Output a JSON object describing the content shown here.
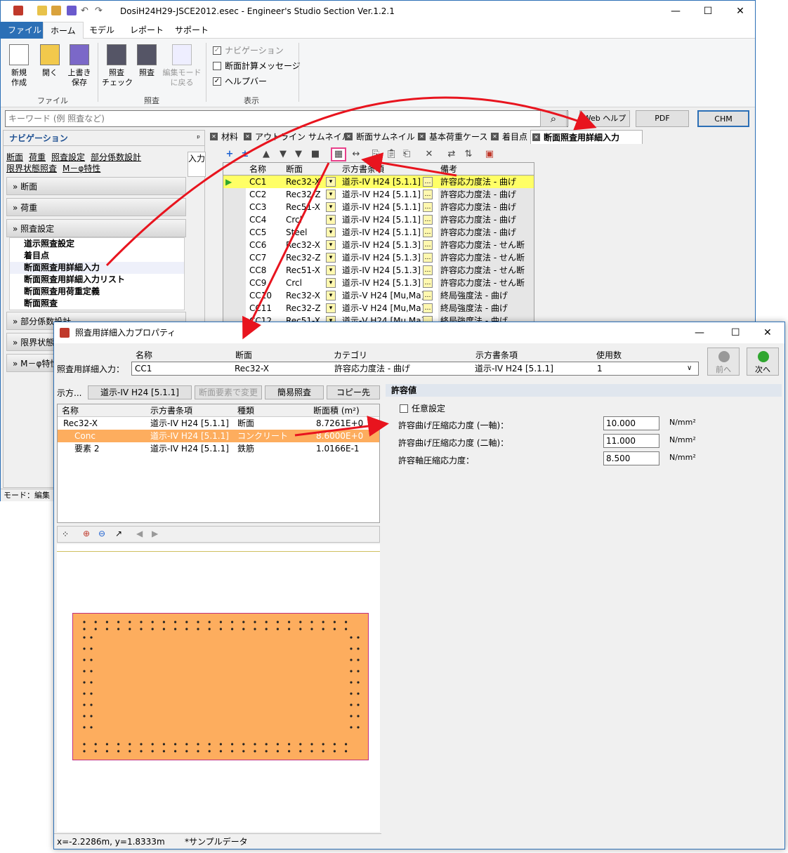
{
  "window": {
    "title": "DosiH24H29-JSCE2012.esec - Engineer's Studio Section Ver.1.2.1",
    "menus": [
      "ファイル",
      "ホーム",
      "モデル",
      "レポート",
      "サポート"
    ],
    "ribbon": {
      "file_group": "ファイル",
      "check_group": "照査",
      "view_group": "表示",
      "buttons": {
        "new": "新規\n作成",
        "open": "開く",
        "save": "上書き\n保存",
        "check_check": "照査\nチェック",
        "check": "照査",
        "back": "編集モード\nに戻る"
      },
      "checks": {
        "navigation": "ナビゲーション",
        "message": "断面計算メッセージ",
        "helpbar": "ヘルプバー"
      }
    },
    "search": {
      "placeholder": "キーワード (例 照査など)",
      "web_help": "Web ヘルプ",
      "pdf": "PDF",
      "chm": "CHM"
    },
    "nav": {
      "title": "ナビゲーション",
      "pin": "ᵖ",
      "links": [
        "断面",
        "荷重",
        "照査設定",
        "部分係数設計",
        "限界状態照査",
        "M－φ特性"
      ],
      "side_tab": "入力",
      "sections": [
        "断面",
        "荷重",
        "照査設定",
        "部分係数設計",
        "限界状態照",
        "M－φ特性"
      ],
      "sub_items": [
        "道示照査設定",
        "着目点",
        "断面照査用詳細入力",
        "断面照査用詳細入力リスト",
        "断面照査用荷重定義",
        "断面照査"
      ]
    },
    "status": "モード：編集",
    "tabs": [
      "材料",
      "アウトライン サムネイル",
      "断面サムネイル",
      "基本荷重ケース",
      "着目点",
      "断面照査用詳細入力"
    ],
    "grid": {
      "headers": [
        "名称",
        "断面",
        "示方書条項",
        "備考"
      ],
      "rows": [
        [
          "CC1",
          "Rec32-X",
          "道示-IV H24 [5.1.1]",
          "許容応力度法 - 曲げ"
        ],
        [
          "CC2",
          "Rec32-Z",
          "道示-IV H24 [5.1.1]",
          "許容応力度法 - 曲げ"
        ],
        [
          "CC3",
          "Rec51-X",
          "道示-IV H24 [5.1.1]",
          "許容応力度法 - 曲げ"
        ],
        [
          "CC4",
          "Crcl",
          "道示-IV H24 [5.1.1]",
          "許容応力度法 - 曲げ"
        ],
        [
          "CC5",
          "Steel",
          "道示-IV H24 [5.1.1]",
          "許容応力度法 - 曲げ"
        ],
        [
          "CC6",
          "Rec32-X",
          "道示-IV H24 [5.1.3]",
          "許容応力度法 - せん断"
        ],
        [
          "CC7",
          "Rec32-Z",
          "道示-IV H24 [5.1.3]",
          "許容応力度法 - せん断"
        ],
        [
          "CC8",
          "Rec51-X",
          "道示-IV H24 [5.1.3]",
          "許容応力度法 - せん断"
        ],
        [
          "CC9",
          "Crcl",
          "道示-IV H24 [5.1.3]",
          "許容応力度法 - せん断"
        ],
        [
          "CC10",
          "Rec32-X",
          "道示-V H24 [Mu,Ma]",
          "終局強度法 - 曲げ"
        ],
        [
          "CC11",
          "Rec32-Z",
          "道示-V H24 [Mu,Ma]",
          "終局強度法 - 曲げ"
        ],
        [
          "CC12",
          "Rec51-X",
          "道示-V H24 [Mu,Ma]",
          "終局強度法 - 曲げ"
        ]
      ]
    }
  },
  "dialog": {
    "title": "照査用詳細入力プロパティ",
    "select_label": "照査用詳細入力：",
    "select_headers": [
      "名称",
      "断面",
      "カテゴリ",
      "示方書条項",
      "使用数"
    ],
    "select_values": [
      "CC1",
      "Rec32-X",
      "許容応力度法 - 曲げ",
      "道示-IV H24 [5.1.1]",
      "1"
    ],
    "prev": "前へ",
    "next": "次へ",
    "spec_label": "示方...",
    "buttons": [
      "道示-IV H24 [5.1.1]",
      "断面要素で変更",
      "簡易照査",
      "コピー先"
    ],
    "list_headers": [
      "名称",
      "示方書条項",
      "種類",
      "断面積 (m²)"
    ],
    "list_rows": [
      [
        "Rec32-X",
        "道示-IV H24 [5.1.1]",
        "断面",
        "8.7261E+0"
      ],
      [
        "Conc",
        "道示-IV H24 [5.1.1]",
        "コンクリート",
        "8.6000E+0"
      ],
      [
        "要素 2",
        "道示-IV H24 [5.1.1]",
        "鉄筋",
        "1.0166E-1"
      ]
    ],
    "status_coords": "x=-2.2286m, y=1.8333m",
    "status_note": "*サンプルデータ",
    "allow": {
      "title": "許容値",
      "custom": "任意設定",
      "rows": [
        {
          "label": "許容曲げ圧縮応力度 (一軸)：",
          "value": "10.000",
          "unit": "N/mm²"
        },
        {
          "label": "許容曲げ圧縮応力度 (二軸)：",
          "value": "11.000",
          "unit": "N/mm²"
        },
        {
          "label": "許容軸圧縮応力度：",
          "value": "8.500",
          "unit": "N/mm²"
        }
      ]
    }
  },
  "colors": {
    "accent": "#2b6fb6",
    "highlight": "#ffff66",
    "selected": "#fdad5e",
    "arrow": "#e8141e"
  }
}
